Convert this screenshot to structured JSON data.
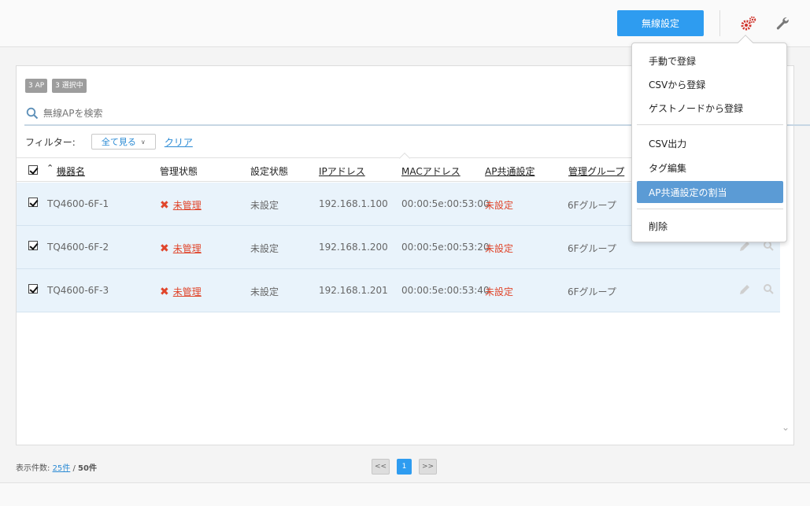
{
  "topbar": {
    "wireless_button": "無線設定",
    "settings_icon": "gears-icon",
    "tools_icon": "wrench-icon"
  },
  "badges": {
    "ap_count": "3 AP",
    "selected": "3 選択中"
  },
  "search": {
    "placeholder": "無線APを検索",
    "value": ""
  },
  "filter": {
    "label": "フィルター:",
    "selected": "全て見る",
    "clear": "クリア"
  },
  "table": {
    "headers": {
      "name": "機器名",
      "management": "管理状態",
      "setting": "設定状態",
      "ip": "IPアドレス",
      "mac": "MACアドレス",
      "ap_common": "AP共通設定",
      "group": "管理グループ"
    },
    "rows": [
      {
        "name": "TQ4600-6F-1",
        "management": "未管理",
        "setting": "未設定",
        "ip": "192.168.1.100",
        "mac": "00:00:5e:00:53:00",
        "ap_common": "未設定",
        "group": "6Fグループ"
      },
      {
        "name": "TQ4600-6F-2",
        "management": "未管理",
        "setting": "未設定",
        "ip": "192.168.1.200",
        "mac": "00:00:5e:00:53:20",
        "ap_common": "未設定",
        "group": "6Fグループ"
      },
      {
        "name": "TQ4600-6F-3",
        "management": "未管理",
        "setting": "未設定",
        "ip": "192.168.1.201",
        "mac": "00:00:5e:00:53:40",
        "ap_common": "未設定",
        "group": "6Fグループ"
      }
    ]
  },
  "footer": {
    "page_size_label": "表示件数:",
    "page_size": "25件",
    "separator": "/",
    "total": "50件",
    "prev": "<<",
    "current_page": "1",
    "next": ">>"
  },
  "menu": {
    "items": [
      "手動で登録",
      "CSVから登録",
      "ゲストノードから登録",
      "CSV出力",
      "タグ編集",
      "AP共通設定の割当",
      "削除"
    ],
    "active_index": 5
  },
  "colors": {
    "accent": "#2e9cf0",
    "error": "#e0452b",
    "row_selected": "#e9f3fb",
    "menu_active": "#5b9bd5"
  }
}
